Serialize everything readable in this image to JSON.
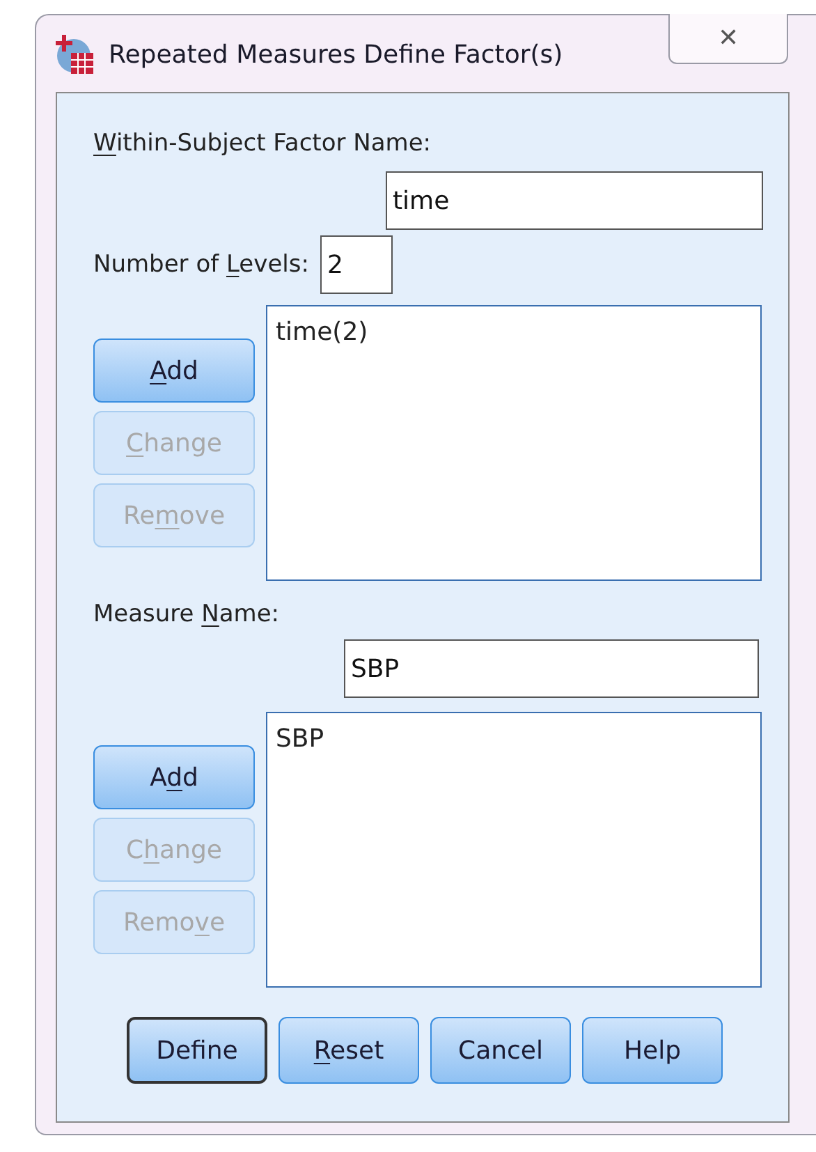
{
  "window": {
    "title": "Repeated Measures Define Factor(s)",
    "close": "✕"
  },
  "factor": {
    "name_label": {
      "key": "W",
      "post": "ithin-Subject Factor Name:"
    },
    "name_value": "time",
    "levels_label": {
      "pre": "Number of ",
      "key": "L",
      "post": "evels:"
    },
    "levels_value": "2",
    "list": [
      "time(2)"
    ],
    "buttons": [
      {
        "label": {
          "key": "A",
          "post": "dd"
        },
        "disabled": false
      },
      {
        "label": {
          "key": "C",
          "post": "hange"
        },
        "disabled": true
      },
      {
        "label": {
          "pre": "Re",
          "key": "m",
          "post": "ove"
        },
        "disabled": true
      }
    ]
  },
  "measure": {
    "name_label": {
      "pre": "Measure ",
      "key": "N",
      "post": "ame:"
    },
    "name_value": "SBP",
    "list": [
      "SBP"
    ],
    "buttons": [
      {
        "label": {
          "pre": "A",
          "key": "d",
          "post": "d"
        },
        "disabled": false
      },
      {
        "label": {
          "pre": "C",
          "key": "h",
          "post": "ange"
        },
        "disabled": true
      },
      {
        "label": {
          "pre": "Remo",
          "key": "v",
          "post": "e"
        },
        "disabled": true
      }
    ]
  },
  "footer": [
    {
      "label": {
        "pre": "Define"
      },
      "default": true
    },
    {
      "label": {
        "key": "R",
        "post": "eset"
      },
      "default": false
    },
    {
      "label": {
        "pre": "Cancel"
      },
      "default": false
    },
    {
      "label": {
        "pre": "Help"
      },
      "default": false
    }
  ]
}
